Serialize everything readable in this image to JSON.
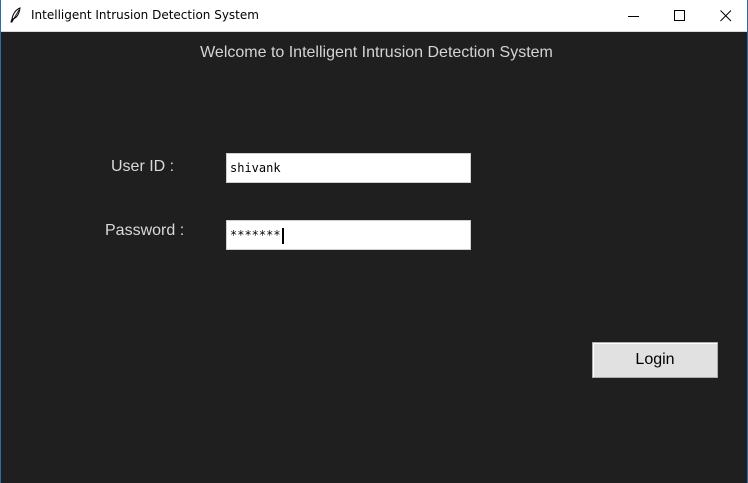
{
  "window": {
    "title": "Intelligent Intrusion Detection System",
    "icons": {
      "app": "feather-icon",
      "minimize": "minimize-icon",
      "maximize": "maximize-icon",
      "close": "close-icon"
    }
  },
  "main": {
    "welcome_text": "Welcome to Intelligent Intrusion Detection System",
    "user_id_label": "User ID :",
    "user_id_value": "shivank",
    "password_label": "Password :",
    "password_value": "*******",
    "login_label": "Login"
  },
  "colors": {
    "background": "#1f1f1f",
    "label_text": "#d9d9d9",
    "button_bg": "#e1e1e1"
  }
}
